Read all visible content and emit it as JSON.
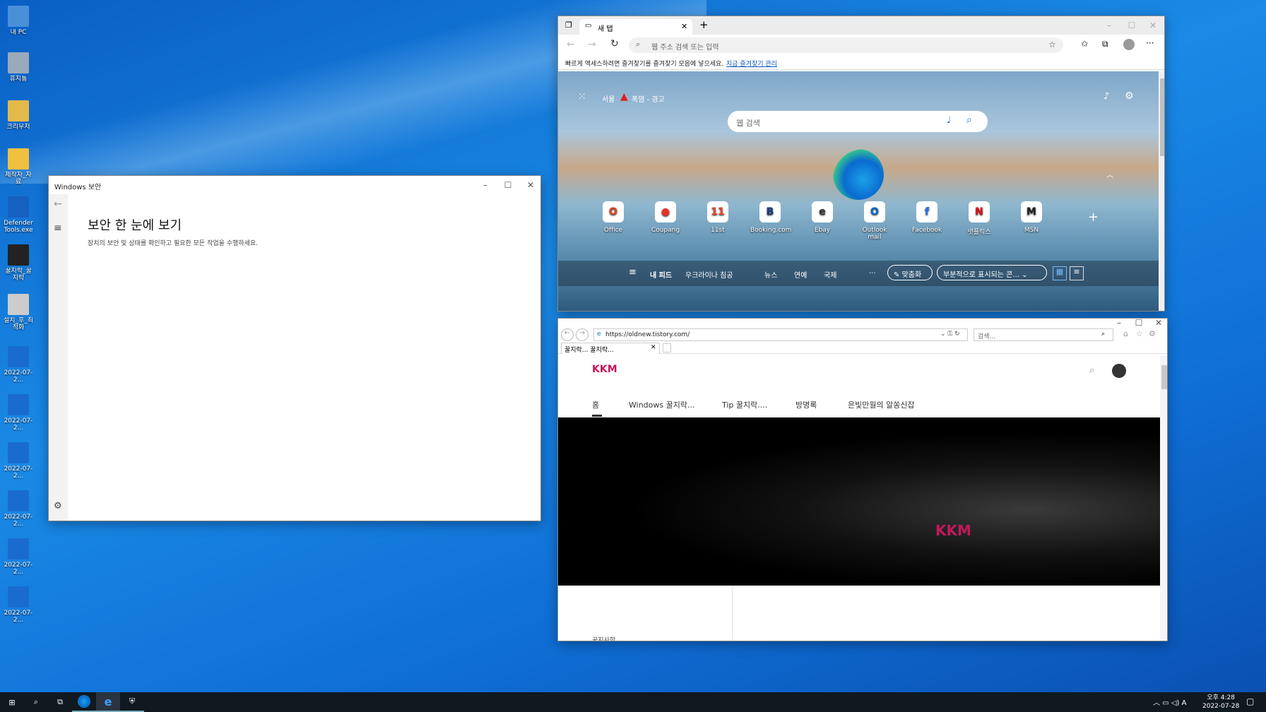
{
  "desktop": {
    "icons": [
      {
        "label": "내 PC",
        "color": "#4a90d9"
      },
      {
        "label": "휴지통",
        "color": "#9ab"
      },
      {
        "label": "크리우저",
        "color": "#e3b94a"
      },
      {
        "label": "제작자_자료",
        "color": "#f0c040"
      },
      {
        "label": "Defender Tools.exe",
        "color": "#1560c0"
      },
      {
        "label": "꿀지락_꿀지락",
        "color": "#222"
      },
      {
        "label": "설치_후_최적화",
        "color": "#ccc"
      },
      {
        "label": "2022-07-2...",
        "color": "#1a6bd0"
      },
      {
        "label": "2022-07-2...",
        "color": "#1a6bd0"
      },
      {
        "label": "2022-07-2...",
        "color": "#1a6bd0"
      },
      {
        "label": "2022-07-2...",
        "color": "#1a6bd0"
      },
      {
        "label": "2022-07-2...",
        "color": "#1a6bd0"
      },
      {
        "label": "2022-07-2...",
        "color": "#1a6bd0"
      }
    ]
  },
  "security": {
    "title": "Windows 보안",
    "heading": "보안 한 눈에 보기",
    "desc": "장치의 보안 및 상태를 확인하고 필요한 모든 작업을 수행하세요."
  },
  "edge": {
    "tab": "새 탭",
    "address_placeholder": "웹 주소 검색 또는 입력",
    "fav_bar": "빠르게 액세스하려면 즐겨찾기를 즐겨찾기 모음에 넣으세요.",
    "fav_link": "지금 즐겨찾기 관리",
    "city": "서울",
    "weather": "폭염 - 경고",
    "search_placeholder": "웹 검색",
    "tiles": [
      {
        "label": "Office",
        "color": "#e3431f",
        "glyph": "O"
      },
      {
        "label": "Coupang",
        "color": "#e8322b",
        "glyph": "●"
      },
      {
        "label": "11st",
        "color": "#f2432c",
        "glyph": "11"
      },
      {
        "label": "Booking.com",
        "color": "#1a3a7a",
        "glyph": "B"
      },
      {
        "label": "Ebay",
        "color": "#333",
        "glyph": "e"
      },
      {
        "label": "Outlook mail",
        "color": "#0a6ad0",
        "glyph": "O"
      },
      {
        "label": "Facebook",
        "color": "#1877f2",
        "glyph": "f"
      },
      {
        "label": "넷플릭스",
        "color": "#e50914",
        "glyph": "N"
      },
      {
        "label": "MSN",
        "color": "#222",
        "glyph": "M"
      }
    ],
    "feed": {
      "my_feed": "내 피드",
      "ukraine": "우크라이나 침공",
      "news": "뉴스",
      "ent": "연예",
      "intl": "국제",
      "more": "...",
      "custom": "맞춤화",
      "partial": "부분적으로 표시되는 콘..."
    }
  },
  "ie": {
    "url": "https://oldnew.tistory.com/",
    "search": "검색...",
    "tab": "꿀지락... 꿀지락...",
    "nav": [
      "홈",
      "Windows 꿀지락...",
      "Tip 꿀지락....",
      "방명록",
      "은빛만월의 알쏭신잡"
    ],
    "notice": "공지사항",
    "logo": "KKM"
  },
  "taskbar": {
    "time": "오후 4:28",
    "date": "2022-07-28",
    "ime": "A"
  }
}
